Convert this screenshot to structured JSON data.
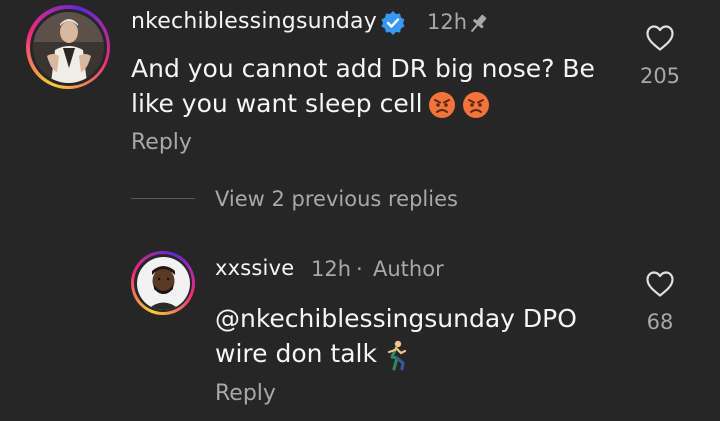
{
  "comment": {
    "username": "nkechiblessingsunday",
    "timestamp": "12h",
    "text_line1": "And you cannot add DR big nose? Be",
    "text_line2": "like you want sleep cell",
    "reply_label": "Reply",
    "like_count": "205",
    "icons": {
      "verified": "verified-badge-icon",
      "pin": "pin-icon",
      "like": "heart-icon",
      "emoji": "angry-face-emoji"
    },
    "colors": {
      "verified": "#3897f0",
      "ring_start": "#f9ce34",
      "ring_mid": "#ee2a7b",
      "ring_end": "#6228d7"
    }
  },
  "thread": {
    "view_previous_label": "View 2 previous replies"
  },
  "reply": {
    "username": "xxssive",
    "timestamp": "12h",
    "separator": "·",
    "author_label": "Author",
    "text_line1": "@nkechiblessingsunday DPO",
    "text_line2": "wire don talk",
    "reply_label": "Reply",
    "like_count": "68",
    "icons": {
      "like": "heart-icon",
      "emoji": "person-running-emoji"
    }
  }
}
